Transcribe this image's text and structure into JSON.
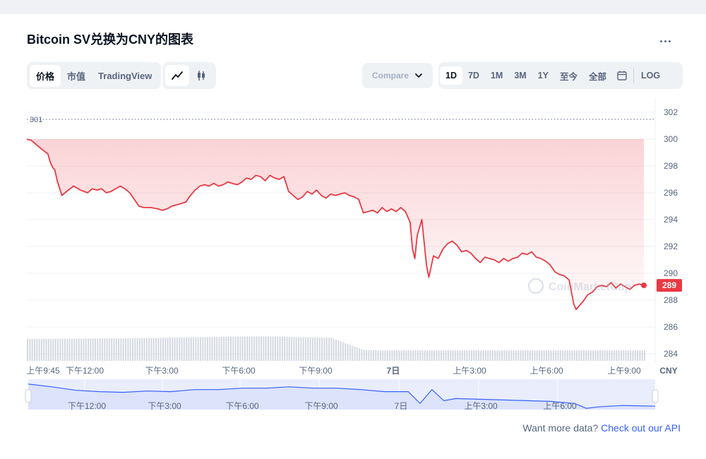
{
  "title": "Bitcoin SV兑换为CNY的图表",
  "more_label": "...",
  "view_tabs": [
    {
      "label": "价格",
      "active": true
    },
    {
      "label": "市值",
      "active": false
    },
    {
      "label": "TradingView",
      "active": false
    }
  ],
  "chart_type_tabs": [
    {
      "icon": "line-chart-icon",
      "active": true
    },
    {
      "icon": "candlestick-icon",
      "active": false
    }
  ],
  "compare": {
    "label": "Compare with"
  },
  "range_tabs": [
    {
      "label": "1D",
      "active": true
    },
    {
      "label": "7D",
      "active": false
    },
    {
      "label": "1M",
      "active": false
    },
    {
      "label": "3M",
      "active": false
    },
    {
      "label": "1Y",
      "active": false
    },
    {
      "label": "至今",
      "active": false
    },
    {
      "label": "全部",
      "active": false
    }
  ],
  "log_label": "LOG",
  "watermark": "CoinMarketCap",
  "footer": {
    "text": "Want more data? ",
    "link": "Check out our API"
  },
  "colors": {
    "line": "#ea3943",
    "accent": "#3861fb",
    "volume": "#d5d9e0",
    "navigator_fill": "#e9edfc",
    "navigator_line": "#3861fb"
  },
  "chart_data": {
    "type": "area",
    "currency": "CNY",
    "ylim": [
      283,
      303
    ],
    "yticks": [
      302,
      300,
      298,
      296,
      294,
      292,
      290,
      288,
      286,
      284
    ],
    "open_price_label": "301",
    "current_price_label": "289",
    "grid": true,
    "xtick_labels": [
      "上午9:45",
      "下午12:00",
      "下午3:00",
      "下午6:00",
      "下午9:00",
      "7日",
      "上午3:00",
      "上午6:00",
      "上午9:00"
    ],
    "navigator_xtick_labels": [
      "下午12:00",
      "下午3:00",
      "下午6:00",
      "下午9:00",
      "7日",
      "上午3:00",
      "上午6:00"
    ],
    "series": [
      {
        "values": [
          [
            0,
            300.0
          ],
          [
            2,
            299.9
          ],
          [
            4,
            299.6
          ],
          [
            6,
            299.3
          ],
          [
            9,
            298.9
          ],
          [
            10,
            298.3
          ],
          [
            11,
            297.9
          ],
          [
            12,
            297.7
          ],
          [
            13,
            296.9
          ],
          [
            15,
            295.8
          ],
          [
            17,
            296.1
          ],
          [
            20,
            296.5
          ],
          [
            23,
            296.2
          ],
          [
            26,
            296.0
          ],
          [
            28,
            296.3
          ],
          [
            30,
            296.2
          ],
          [
            32,
            296.3
          ],
          [
            34,
            296.0
          ],
          [
            36,
            296.1
          ],
          [
            38,
            296.3
          ],
          [
            40,
            296.5
          ],
          [
            42,
            296.3
          ],
          [
            44,
            296.0
          ],
          [
            46,
            295.5
          ],
          [
            48,
            295.0
          ],
          [
            50,
            294.9
          ],
          [
            53,
            294.9
          ],
          [
            56,
            294.8
          ],
          [
            58,
            294.7
          ],
          [
            60,
            294.8
          ],
          [
            62,
            295.0
          ],
          [
            64,
            295.1
          ],
          [
            66,
            295.2
          ],
          [
            68,
            295.3
          ],
          [
            70,
            295.8
          ],
          [
            72,
            296.2
          ],
          [
            74,
            296.5
          ],
          [
            76,
            296.6
          ],
          [
            78,
            296.5
          ],
          [
            80,
            296.7
          ],
          [
            82,
            296.5
          ],
          [
            84,
            296.6
          ],
          [
            86,
            296.8
          ],
          [
            88,
            296.7
          ],
          [
            90,
            296.6
          ],
          [
            92,
            296.8
          ],
          [
            94,
            297.1
          ],
          [
            96,
            297.0
          ],
          [
            98,
            297.3
          ],
          [
            100,
            297.2
          ],
          [
            102,
            296.9
          ],
          [
            104,
            297.3
          ],
          [
            106,
            297.1
          ],
          [
            108,
            297.0
          ],
          [
            110,
            297.2
          ],
          [
            112,
            296.1
          ],
          [
            114,
            295.8
          ],
          [
            116,
            295.5
          ],
          [
            118,
            295.7
          ],
          [
            120,
            296.1
          ],
          [
            122,
            295.9
          ],
          [
            124,
            296.2
          ],
          [
            126,
            295.8
          ],
          [
            128,
            295.6
          ],
          [
            130,
            295.9
          ],
          [
            132,
            295.8
          ],
          [
            134,
            295.9
          ],
          [
            136,
            296.0
          ],
          [
            138,
            295.8
          ],
          [
            140,
            295.7
          ],
          [
            142,
            295.5
          ],
          [
            144,
            294.5
          ],
          [
            146,
            294.6
          ],
          [
            148,
            294.7
          ],
          [
            150,
            294.5
          ],
          [
            152,
            294.9
          ],
          [
            154,
            294.6
          ],
          [
            156,
            294.8
          ],
          [
            158,
            294.6
          ],
          [
            160,
            294.9
          ],
          [
            162,
            294.6
          ],
          [
            164,
            293.8
          ],
          [
            165,
            291.8
          ],
          [
            166,
            291.1
          ],
          [
            167,
            292.8
          ],
          [
            169,
            294.0
          ],
          [
            170,
            292.3
          ],
          [
            171,
            290.6
          ],
          [
            172,
            289.7
          ],
          [
            174,
            291.3
          ],
          [
            176,
            291.1
          ],
          [
            178,
            291.8
          ],
          [
            180,
            292.2
          ],
          [
            182,
            292.4
          ],
          [
            184,
            292.1
          ],
          [
            186,
            291.6
          ],
          [
            188,
            291.7
          ],
          [
            190,
            291.5
          ],
          [
            192,
            291.1
          ],
          [
            194,
            290.8
          ],
          [
            196,
            291.2
          ],
          [
            198,
            291.1
          ],
          [
            200,
            291.0
          ],
          [
            202,
            290.8
          ],
          [
            204,
            291.1
          ],
          [
            206,
            290.9
          ],
          [
            208,
            291.1
          ],
          [
            210,
            291.2
          ],
          [
            212,
            291.5
          ],
          [
            214,
            291.4
          ],
          [
            216,
            291.6
          ],
          [
            218,
            291.2
          ],
          [
            220,
            291.1
          ],
          [
            222,
            290.9
          ],
          [
            224,
            290.6
          ],
          [
            226,
            290.1
          ],
          [
            228,
            289.9
          ],
          [
            230,
            289.8
          ],
          [
            232,
            289.5
          ],
          [
            233,
            288.6
          ],
          [
            234,
            287.7
          ],
          [
            235,
            287.3
          ],
          [
            236,
            287.5
          ],
          [
            238,
            287.9
          ],
          [
            240,
            288.4
          ],
          [
            242,
            288.6
          ],
          [
            244,
            289.0
          ],
          [
            246,
            289.1
          ],
          [
            248,
            289.0
          ],
          [
            250,
            289.3
          ],
          [
            252,
            288.9
          ],
          [
            254,
            289.2
          ],
          [
            256,
            289.0
          ],
          [
            258,
            288.8
          ],
          [
            260,
            289.1
          ],
          [
            262,
            289.2
          ],
          [
            264,
            289.1
          ]
        ]
      }
    ],
    "volume_levels": [
      [
        0,
        0.42
      ],
      [
        40,
        0.43
      ],
      [
        100,
        0.47
      ],
      [
        130,
        0.44
      ],
      [
        139,
        0.29
      ],
      [
        144,
        0.21
      ],
      [
        150,
        0.2
      ],
      [
        170,
        0.2
      ],
      [
        200,
        0.2
      ],
      [
        264,
        0.2
      ]
    ],
    "navigator_values": [
      [
        0,
        0.14
      ],
      [
        10,
        0.22
      ],
      [
        20,
        0.32
      ],
      [
        30,
        0.36
      ],
      [
        40,
        0.38
      ],
      [
        50,
        0.34
      ],
      [
        60,
        0.36
      ],
      [
        70,
        0.3
      ],
      [
        80,
        0.3
      ],
      [
        90,
        0.26
      ],
      [
        100,
        0.26
      ],
      [
        110,
        0.22
      ],
      [
        120,
        0.26
      ],
      [
        130,
        0.26
      ],
      [
        140,
        0.3
      ],
      [
        150,
        0.36
      ],
      [
        160,
        0.36
      ],
      [
        165,
        0.7
      ],
      [
        170,
        0.3
      ],
      [
        175,
        0.62
      ],
      [
        180,
        0.56
      ],
      [
        190,
        0.58
      ],
      [
        200,
        0.6
      ],
      [
        210,
        0.62
      ],
      [
        220,
        0.64
      ],
      [
        230,
        0.7
      ],
      [
        235,
        0.84
      ],
      [
        240,
        0.8
      ],
      [
        250,
        0.76
      ],
      [
        264,
        0.78
      ]
    ]
  }
}
